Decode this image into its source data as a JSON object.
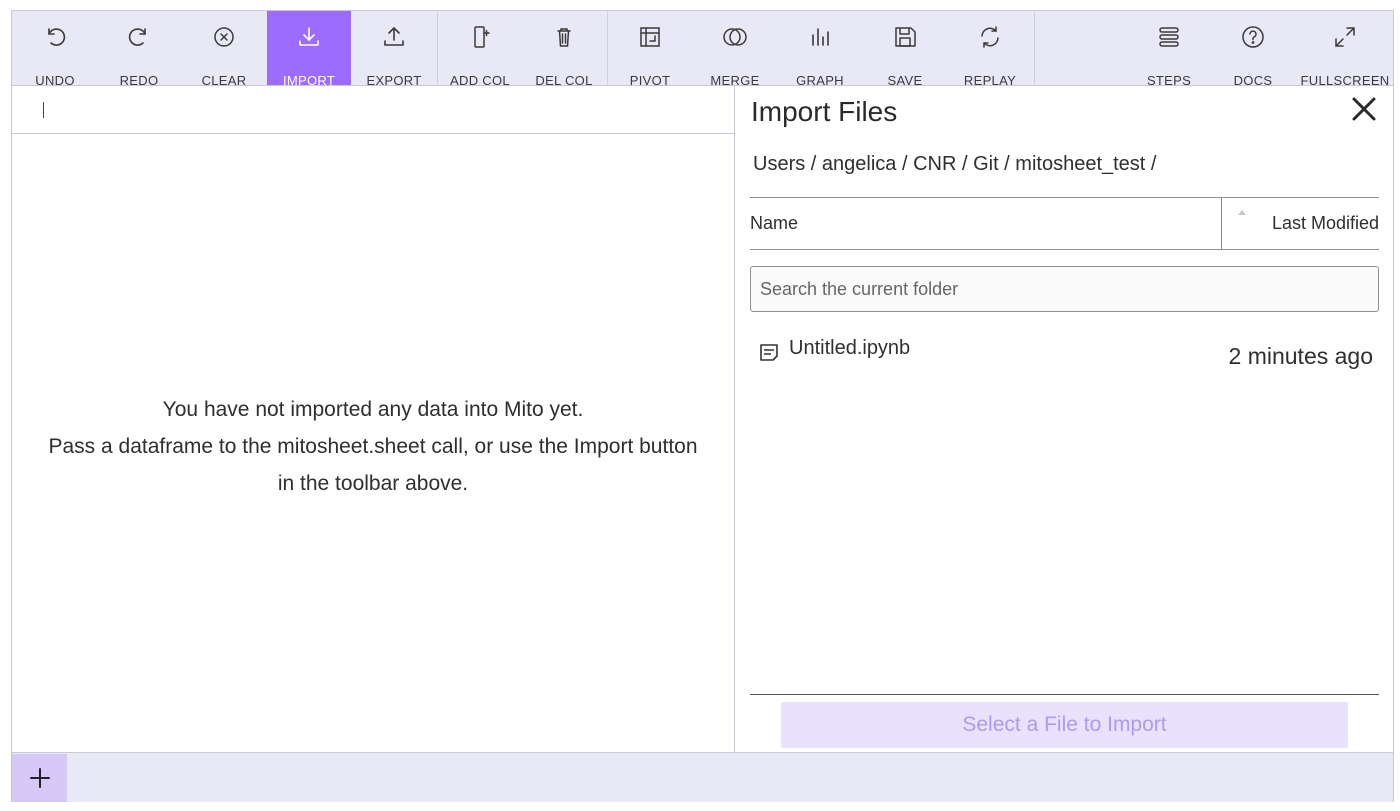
{
  "toolbar": {
    "buttons": [
      {
        "label": "UNDO",
        "icon": "undo-icon"
      },
      {
        "label": "REDO",
        "icon": "redo-icon"
      },
      {
        "label": "CLEAR",
        "icon": "clear-icon"
      },
      {
        "label": "IMPORT",
        "icon": "import-icon",
        "active": true
      },
      {
        "label": "EXPORT",
        "icon": "export-icon"
      },
      {
        "label": "ADD COL",
        "icon": "add-column-icon"
      },
      {
        "label": "DEL COL",
        "icon": "delete-column-icon"
      },
      {
        "label": "PIVOT",
        "icon": "pivot-icon"
      },
      {
        "label": "MERGE",
        "icon": "merge-icon"
      },
      {
        "label": "GRAPH",
        "icon": "graph-icon"
      },
      {
        "label": "SAVE",
        "icon": "save-icon"
      },
      {
        "label": "REPLAY",
        "icon": "replay-icon"
      },
      {
        "label": "STEPS",
        "icon": "steps-icon"
      },
      {
        "label": "DOCS",
        "icon": "docs-icon"
      },
      {
        "label": "FULLSCREEN",
        "icon": "fullscreen-icon"
      }
    ],
    "active_color": "#9d6cff",
    "background": "#e8e8f7"
  },
  "sheet": {
    "empty_message": [
      "You have not imported any data into Mito yet.",
      "Pass a dataframe to the mitosheet.sheet call, or use the Import button",
      "in the toolbar above."
    ]
  },
  "import_panel": {
    "title": "Import Files",
    "close_icon": "close-icon",
    "breadcrumb": "Users / angelica / CNR / Git / mitosheet_test /",
    "columns": {
      "name": "Name",
      "modified": "Last Modified"
    },
    "search_placeholder": "Search the current folder",
    "files": [
      {
        "name": "Untitled.ipynb",
        "modified": "2 minutes ago",
        "icon": "file-icon"
      }
    ],
    "import_button": "Select a File to Import"
  },
  "footer": {
    "add_sheet_icon": "plus-icon"
  }
}
